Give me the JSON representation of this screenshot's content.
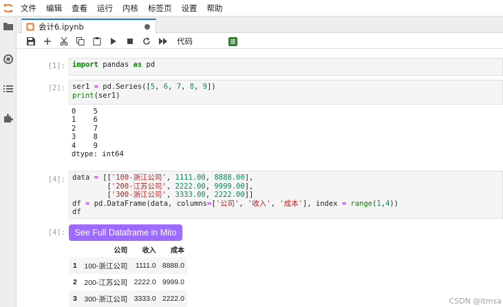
{
  "app": {
    "logo_icon": "jupyter-logo"
  },
  "menu": [
    "文件",
    "编辑",
    "查看",
    "运行",
    "内核",
    "标签页",
    "设置",
    "帮助"
  ],
  "sidebar": [
    {
      "icon": "folder-icon"
    },
    {
      "icon": "running-icon"
    },
    {
      "icon": "toc-list-icon"
    },
    {
      "icon": "extension-icon"
    }
  ],
  "tab": {
    "label": "会计6.ipynb",
    "icon": "notebook-icon",
    "dirty": true
  },
  "toolbar": {
    "icons": [
      "save-icon",
      "add-cell-icon",
      "cut-icon",
      "copy-icon",
      "paste-icon",
      "run-icon",
      "stop-icon",
      "restart-icon",
      "run-all-icon"
    ],
    "cell_type": "代码"
  },
  "cells": {
    "c1": {
      "prompt": "[1]:",
      "code": [
        "import pandas as pd"
      ]
    },
    "c2": {
      "prompt": "[2]:",
      "code": [
        "ser1 = pd.Series([5, 6, 7, 8, 9])",
        "print(ser1)"
      ],
      "output": [
        "0    5",
        "1    6",
        "2    7",
        "3    8",
        "4    9",
        "dtype: int64"
      ]
    },
    "c3": {
      "prompt": "[4]:",
      "code": [
        "data = [['100-浙江公司', 1111.00, 8888.00],",
        "        ['200-江苏公司', 2222.00, 9999.00],",
        "        ['300-浙江公司', 3333.00, 2222.00]]",
        "df = pd.DataFrame(data, columns=['公司', '收入', '成本'], index = range(1,4))",
        "df"
      ]
    },
    "out4": {
      "prompt": "[4]:",
      "mito_button": "See Full Dataframe in Mito",
      "table": {
        "columns": [
          "",
          "公司",
          "收入",
          "成本"
        ],
        "rows": [
          [
            "1",
            "100-浙江公司",
            "1111.0",
            "8888.0"
          ],
          [
            "2",
            "200-江苏公司",
            "2222.0",
            "9999.0"
          ],
          [
            "3",
            "300-浙江公司",
            "3333.0",
            "2222.0"
          ]
        ]
      }
    }
  },
  "watermark": "CSDN @ltmsa",
  "colors": {
    "accent": "#1976d2",
    "mito": "#9d6cff",
    "editor_bg": "#f5f5f5"
  }
}
